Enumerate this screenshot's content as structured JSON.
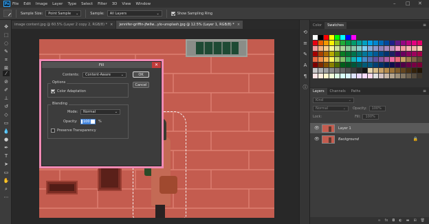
{
  "app": {
    "logo": "Ps"
  },
  "menubar": {
    "items": [
      "File",
      "Edit",
      "Image",
      "Layer",
      "Type",
      "Select",
      "Filter",
      "3D",
      "View",
      "Window"
    ]
  },
  "window_controls": {
    "minimize": "–",
    "maximize": "□",
    "close": "✕"
  },
  "options_bar": {
    "sample_size_label": "Sample Size:",
    "sample_size_value": "Point Sample",
    "sample_label": "Sample:",
    "sample_value": "All Layers",
    "show_ring_label": "Show Sampling Ring",
    "show_ring_checked": true
  },
  "doc_tabs": [
    {
      "title": "image content.jpg @ 60.5% (Layer 2 copy 2, RGB/8) *",
      "close": "×",
      "active": false
    },
    {
      "title": "jennifer-griffin-jfwllw...ylo-unsplash.jpg @ 12.5% (Layer 1, RGB/8) *",
      "close": "×",
      "active": true
    }
  ],
  "fill_dialog": {
    "title": "Fill",
    "close": "✕",
    "contents_label": "Contents:",
    "contents_value": "Content-Aware",
    "ok_label": "OK",
    "cancel_label": "Cancel",
    "options_label": "Options",
    "color_adaptation_label": "Color Adaptation",
    "color_adaptation_checked": true,
    "blending_label": "Blending",
    "mode_label": "Mode:",
    "mode_value": "Normal",
    "opacity_label": "Opacity:",
    "opacity_value": "100",
    "opacity_unit": "%",
    "preserve_label": "Preserve Transparency",
    "preserve_checked": false
  },
  "swatches_panel": {
    "tabs": [
      "Color",
      "Swatches"
    ],
    "active_tab": "Swatches",
    "rows": [
      [
        "#ffffff",
        "#000000",
        "#ff0000",
        "#ffff00",
        "#00ff00",
        "#00ffff",
        "#0000ff",
        "#ff00ff"
      ],
      [
        "#e60012",
        "#eb6100",
        "#f39800",
        "#fff100",
        "#8fc31f",
        "#22ac38",
        "#009944",
        "#009b6b",
        "#009e96",
        "#00a0c1",
        "#00a0e9",
        "#0086d1",
        "#0068b7",
        "#00479d",
        "#1d2088",
        "#601986",
        "#920783",
        "#be0081",
        "#e4007f",
        "#e5006a"
      ],
      [
        "#f29c9f",
        "#f6b37f",
        "#facd89",
        "#fff799",
        "#cce198",
        "#acd598",
        "#89c997",
        "#8ac6a9",
        "#84ccc9",
        "#7ecef4",
        "#88abda",
        "#8c97cb",
        "#8f82bc",
        "#aa89bd",
        "#c490bf",
        "#f19ec2",
        "#f29c9f",
        "#f5b2b2",
        "#f0b4a8",
        "#f8cdb4"
      ],
      [
        "#a40000",
        "#a84200",
        "#ac6a00",
        "#b7aa00",
        "#638c0b",
        "#097c25",
        "#007130",
        "#00734c",
        "#007471",
        "#007799",
        "#0075a9",
        "#005b98",
        "#004986",
        "#003471",
        "#1d2062",
        "#440062",
        "#6a005f",
        "#8b005f",
        "#9d005d",
        "#a10049"
      ],
      [
        "#ec6941",
        "#f19149",
        "#f8b551",
        "#fff45c",
        "#b3d465",
        "#80c269",
        "#32b16c",
        "#13b5b1",
        "#00b7ee",
        "#448aca",
        "#556fb5",
        "#5f52a0",
        "#8957a1",
        "#ae5da1",
        "#ea68a2",
        "#eb6877",
        "#c9a063",
        "#a07e4c",
        "#7f6244",
        "#5f4a36"
      ],
      [
        "#7d0000",
        "#7f2c00",
        "#835000",
        "#8a8000",
        "#4b6a00",
        "#005e1a",
        "#005321",
        "#005538",
        "#005652",
        "#005b77",
        "#005882",
        "#004074",
        "#003167",
        "#002157",
        "#100c4b",
        "#320049",
        "#500047",
        "#680046",
        "#770043",
        "#7a0036"
      ],
      [
        "#c8c8c8",
        "#b4b4b4",
        "#a0a0a0",
        "#8c8c8c",
        "#787878",
        "#646464",
        "#505050",
        "#3c3c3c",
        "#282828",
        "#141414",
        "#e6d6b0",
        "#d6bd8a",
        "#c9a36a",
        "#b68b4c",
        "#9c7238",
        "#7f5b2a",
        "#63451e",
        "#4a3214",
        "#34220b",
        "#231605"
      ],
      [
        "#ffe5e5",
        "#ffeedd",
        "#fff6cc",
        "#f0ffd9",
        "#dcffe6",
        "#d9fff8",
        "#d9f3ff",
        "#dde3ff",
        "#ead9ff",
        "#fadcff",
        "#ffd9ec",
        "#e0e0e0",
        "#d4c3c3",
        "#c9b8a8",
        "#b5a58f",
        "#9e907a",
        "#857864",
        "#6d614f",
        "#574d3e",
        "#3f372c"
      ]
    ]
  },
  "layers_panel": {
    "tabs": [
      "Layers",
      "Channels",
      "Paths"
    ],
    "active_tab": "Layers",
    "kind_label": "Kind",
    "blend_value": "Normal",
    "opacity_label": "Opacity:",
    "opacity_value": "100%",
    "fill_label": "Fill:",
    "fill_value": "100%",
    "lock_label": "Lock:",
    "layers": [
      {
        "name": "Layer 1",
        "selected": true,
        "locked": false
      },
      {
        "name": "Background",
        "selected": false,
        "locked": true
      }
    ],
    "footer_icons": [
      "link-icon",
      "fx-icon",
      "mask-icon",
      "adjustment-icon",
      "folder-icon",
      "new-layer-icon",
      "trash-icon"
    ]
  }
}
